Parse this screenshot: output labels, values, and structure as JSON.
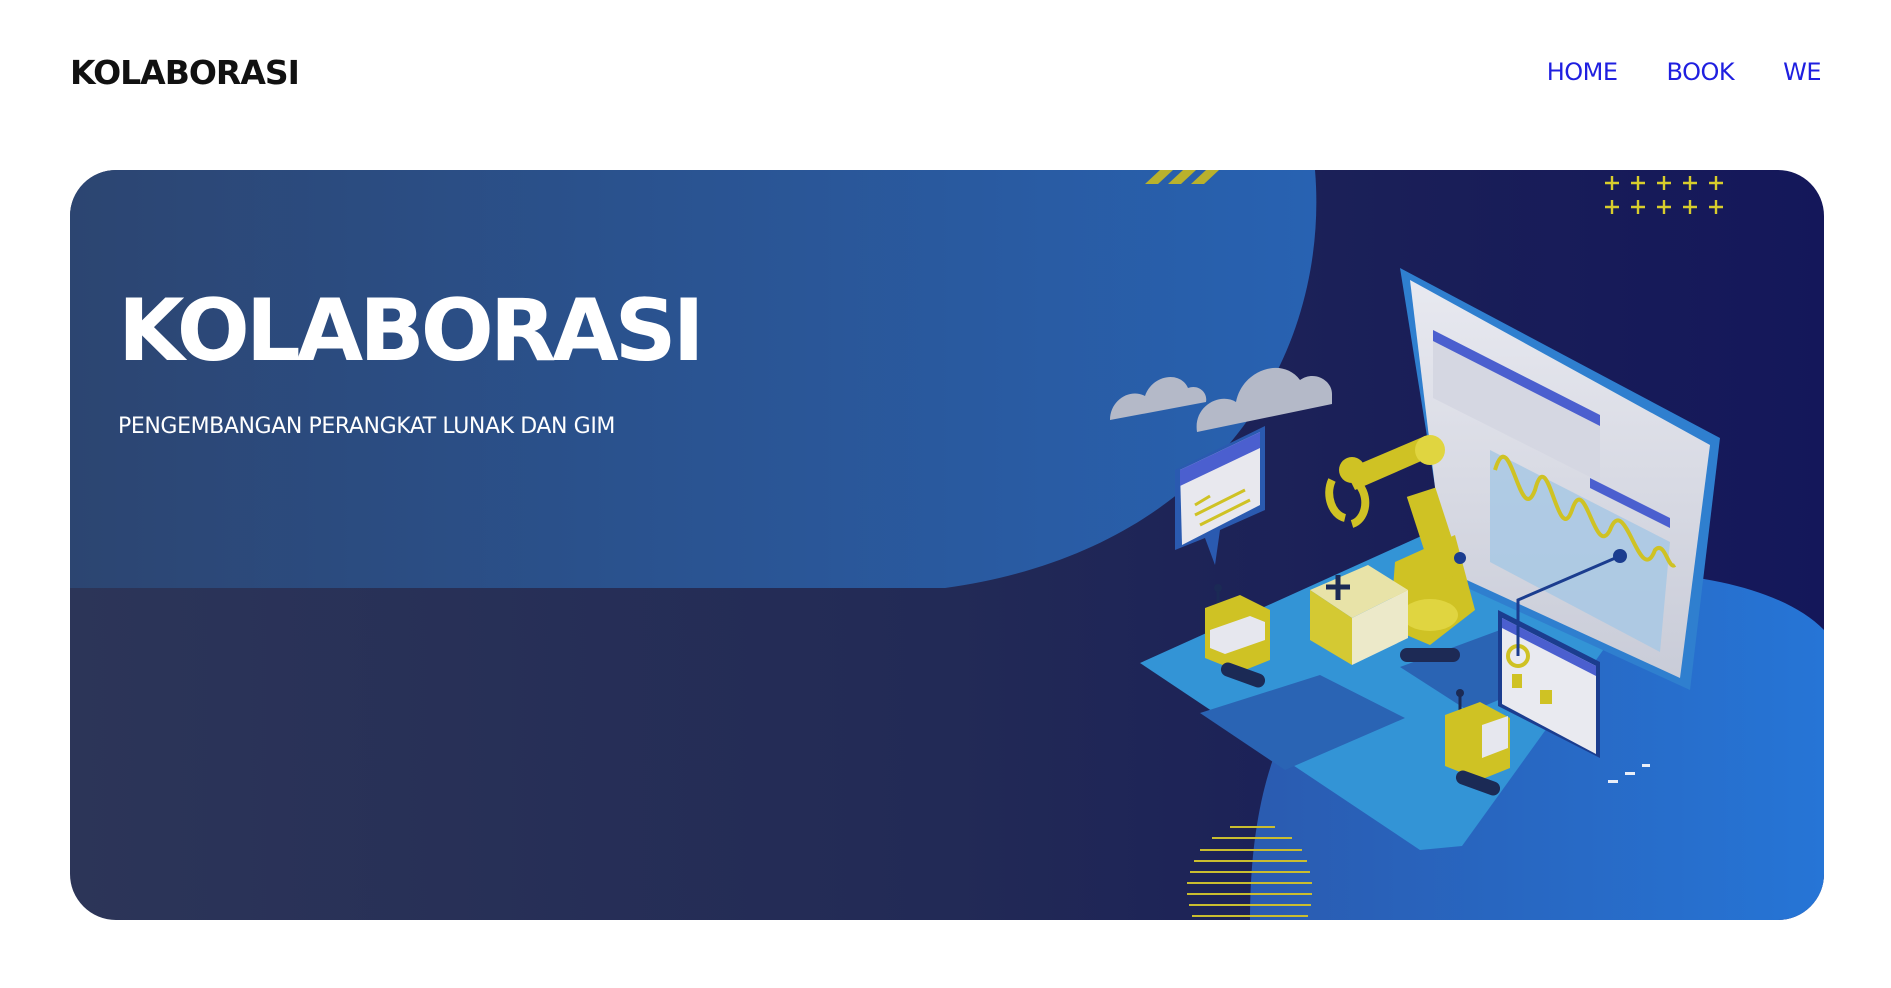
{
  "navbar": {
    "brand": "KOLABORASI",
    "links": [
      {
        "label": "HOME"
      },
      {
        "label": "BOOK"
      },
      {
        "label": "WE"
      }
    ]
  },
  "hero": {
    "title": "KOLABORASI",
    "subtitle": "PENGEMBANGAN PERANGKAT LUNAK DAN GIM",
    "illustration": "robot-arm-laptop-software-development-illustration"
  },
  "colors": {
    "nav_link": "#1f1fe0",
    "hero_dark": "#1a1f58",
    "hero_blue": "#2b5ea8",
    "accent_yellow": "#cfc224",
    "laptop_blue": "#3394d6"
  }
}
